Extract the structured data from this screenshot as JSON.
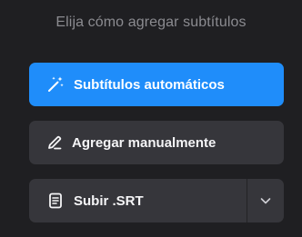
{
  "heading": "Elija cómo agregar subtítulos",
  "options": {
    "auto": {
      "label": "Subtítulos automáticos",
      "icon": "magic-wand-icon"
    },
    "manual": {
      "label": "Agregar manualmente",
      "icon": "pencil-icon"
    },
    "srt": {
      "label": "Subir .SRT",
      "icon": "document-icon",
      "dropdown_icon": "chevron-down-icon"
    }
  },
  "colors": {
    "background": "#1f1f22",
    "primary": "#1f8dfa",
    "secondary": "#36363b",
    "heading_text": "#8b8b90"
  }
}
